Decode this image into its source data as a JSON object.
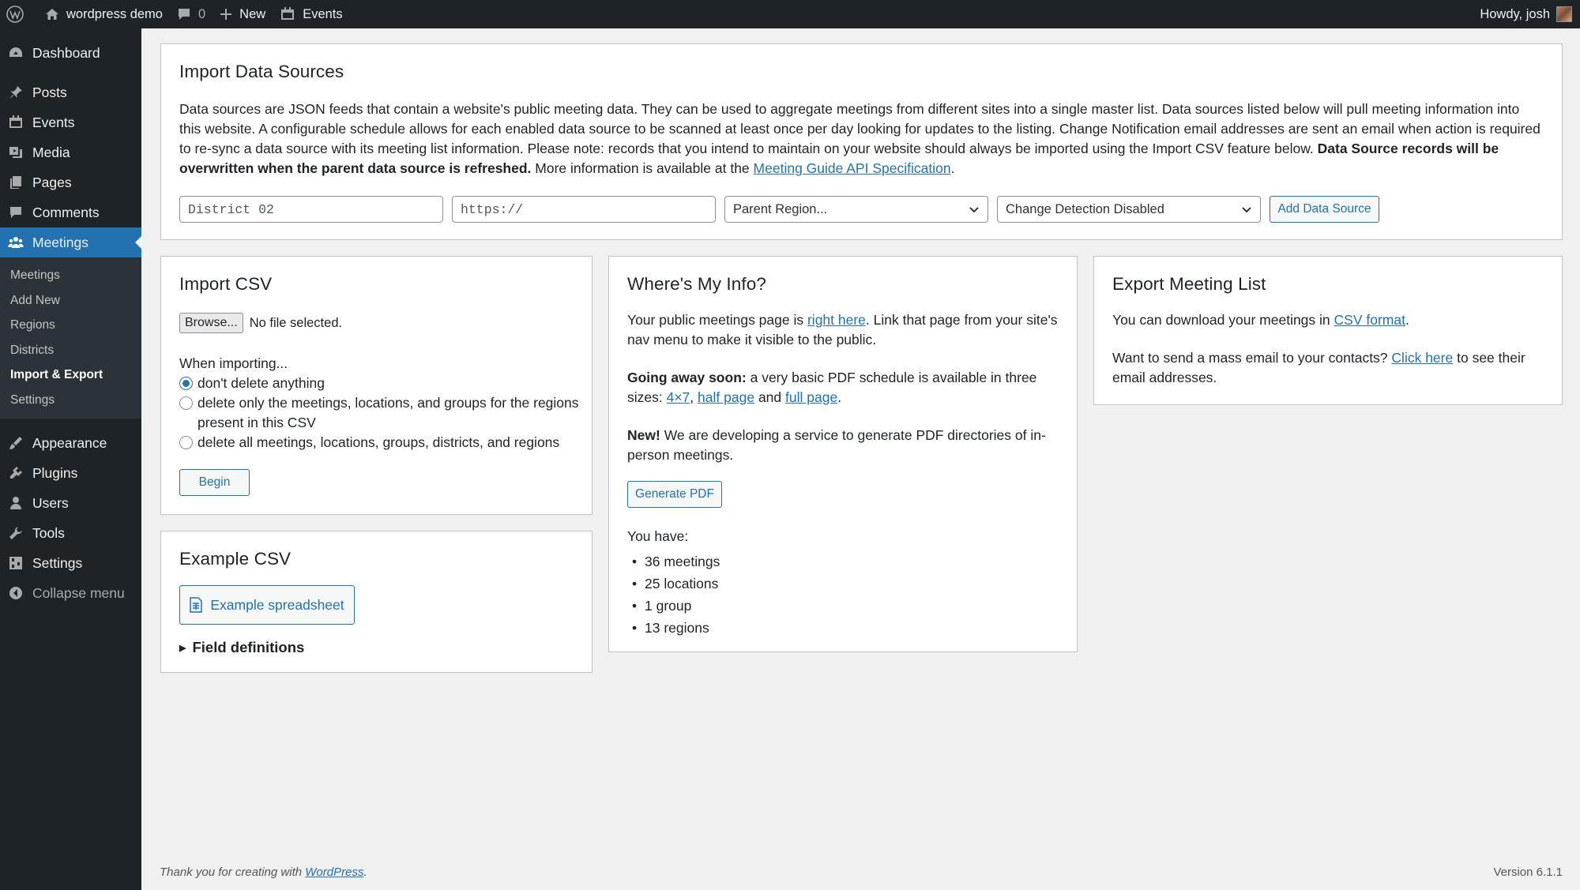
{
  "admin_bar": {
    "site_name": "wordpress demo",
    "comments_count": "0",
    "new_label": "New",
    "events_label": "Events",
    "greeting": "Howdy, josh"
  },
  "sidebar": {
    "items_top": [
      {
        "label": "Dashboard",
        "icon": "dashboard-icon"
      }
    ],
    "items_mid": [
      {
        "label": "Posts",
        "icon": "pin-icon"
      },
      {
        "label": "Events",
        "icon": "calendar-icon"
      },
      {
        "label": "Media",
        "icon": "media-icon"
      },
      {
        "label": "Pages",
        "icon": "page-icon"
      },
      {
        "label": "Comments",
        "icon": "comment-icon"
      }
    ],
    "current": {
      "label": "Meetings",
      "icon": "groups-icon"
    },
    "submenu": [
      "Meetings",
      "Add New",
      "Regions",
      "Districts",
      "Import & Export",
      "Settings"
    ],
    "submenu_current_index": 4,
    "items_bottom": [
      {
        "label": "Appearance",
        "icon": "brush-icon"
      },
      {
        "label": "Plugins",
        "icon": "plugin-icon"
      },
      {
        "label": "Users",
        "icon": "user-icon"
      },
      {
        "label": "Tools",
        "icon": "wrench-icon"
      },
      {
        "label": "Settings",
        "icon": "sliders-icon"
      }
    ],
    "collapse_label": "Collapse menu"
  },
  "import_data_sources": {
    "title": "Import Data Sources",
    "desc_1": "Data sources are JSON feeds that contain a website's public meeting data. They can be used to aggregate meetings from different sites into a single master list. Data sources listed below will pull meeting information into this website. A configurable schedule allows for each enabled data source to be scanned at least once per day looking for updates to the listing. Change Notification email addresses are sent an email when action is required to re-sync a data source with its meeting list information. Please note: records that you intend to maintain on your website should always be imported using the Import CSV feature below.",
    "desc_bold": "Data Source records will be overwritten when the parent data source is refreshed.",
    "desc_2": "More information is available at the",
    "desc_link": "Meeting Guide API Specification",
    "desc_end": ".",
    "name_placeholder": "District 02",
    "url_placeholder": "https://",
    "parent_region": "Parent Region...",
    "change_detection": "Change Detection Disabled",
    "add_button": "Add Data Source"
  },
  "import_csv": {
    "title": "Import CSV",
    "browse_label": "Browse...",
    "file_status": "No file selected.",
    "when_importing": "When importing...",
    "options": [
      "don't delete anything",
      "delete only the meetings, locations, and groups for the regions present in this CSV",
      "delete all meetings, locations, groups, districts, and regions"
    ],
    "selected_index": 0,
    "begin_label": "Begin"
  },
  "example_csv": {
    "title": "Example CSV",
    "button_label": "Example spreadsheet",
    "field_definitions": "Field definitions"
  },
  "wheres_my_info": {
    "title": "Where's My Info?",
    "p1_a": "Your public meetings page is",
    "p1_link": "right here",
    "p1_b": ". Link that page from your site's nav menu to make it visible to the public.",
    "p2_bold": "Going away soon:",
    "p2_a": "a very basic PDF schedule is available in three sizes:",
    "p2_link1": "4×7",
    "p2_sep1": ",",
    "p2_link2": "half page",
    "p2_and": "and",
    "p2_link3": "full page",
    "p2_end": ".",
    "p3_bold": "New!",
    "p3_a": "We are developing a service to generate PDF directories of in-person meetings.",
    "generate_label": "Generate PDF",
    "you_have": "You have:",
    "counts": [
      "36 meetings",
      "25 locations",
      "1 group",
      "13 regions"
    ]
  },
  "export": {
    "title": "Export Meeting List",
    "p1_a": "You can download your meetings in",
    "p1_link": "CSV format",
    "p1_end": ".",
    "p2_a": "Want to send a mass email to your contacts?",
    "p2_link": "Click here",
    "p2_b": "to see their email addresses."
  },
  "footer": {
    "thanks": "Thank you for creating with",
    "wp_link": "WordPress",
    "thanks_end": ".",
    "version": "Version 6.1.1"
  },
  "colors": {
    "admin_dark": "#1d2327",
    "accent": "#2271b1",
    "background": "#f0f0f1"
  }
}
